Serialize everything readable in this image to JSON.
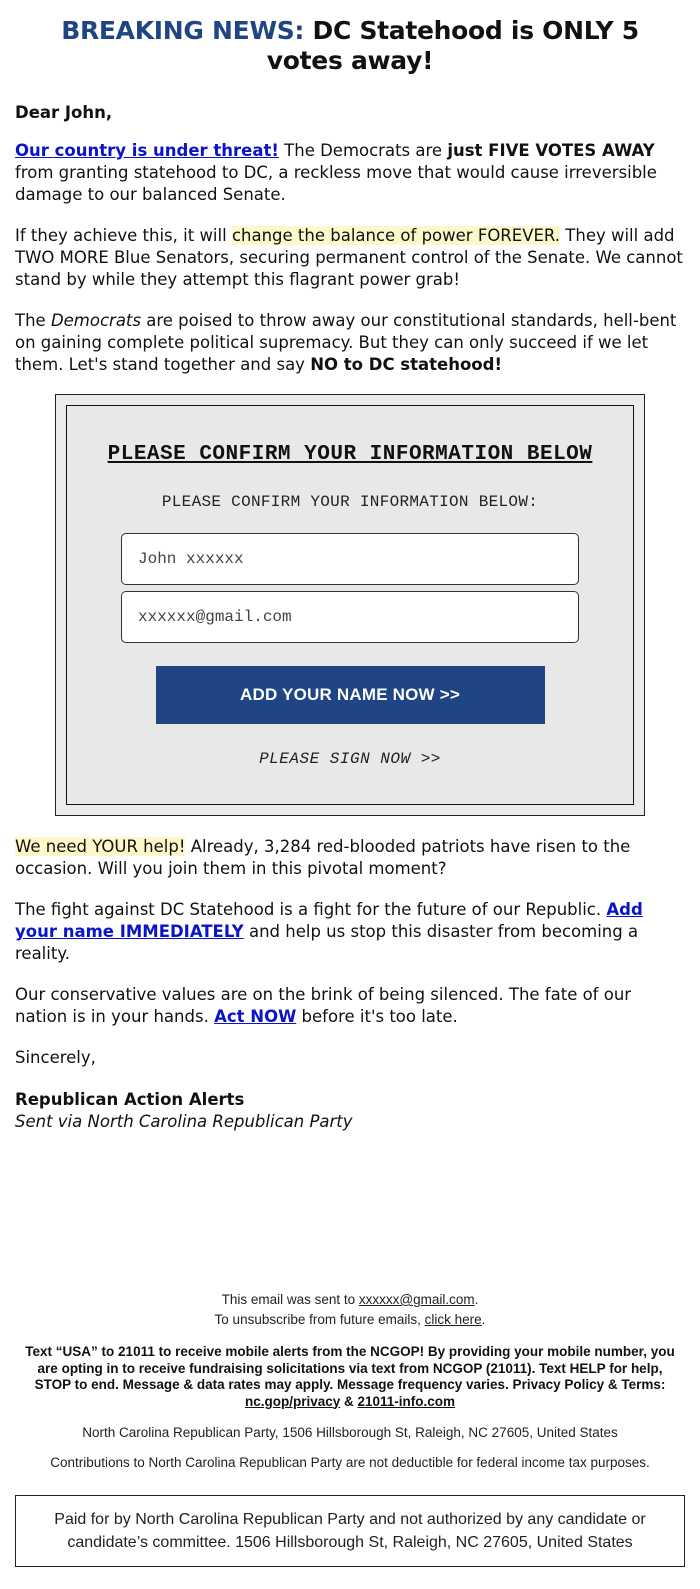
{
  "headline": {
    "lead": "BREAKING NEWS:",
    "rest": " DC Statehood is ONLY 5 votes away!"
  },
  "greeting": "Dear John,",
  "paragraphs": {
    "p1": {
      "link": "Our country is under threat!",
      "text1": " The Democrats are ",
      "bold": "just FIVE VOTES AWAY",
      "text2": " from granting statehood to DC, a reckless move that would cause irreversible damage to our balanced Senate."
    },
    "p2": {
      "text1": "If they achieve this, it will ",
      "highlight": "change the balance of power FOREVER.",
      "text2": " They will add TWO MORE Blue Senators, securing permanent control of the Senate. We cannot stand by while they attempt this flagrant power grab!"
    },
    "p3": {
      "text1": "The ",
      "italic": "Democrats",
      "text2": " are poised to throw away our constitutional standards, hell-bent on gaining complete political supremacy. But they can only succeed if we let them. Let's stand together and say ",
      "bold": "NO to DC statehood!"
    },
    "p4": {
      "highlight": "We need YOUR help!",
      "text": " Already, 3,284 red-blooded patriots have risen to the occasion. Will you join them in this pivotal moment?"
    },
    "p5": {
      "text1": "The fight against DC Statehood is a fight for the future of our Republic. ",
      "link": "Add your name IMMEDIATELY",
      "text2": " and help us stop this disaster from becoming a reality."
    },
    "p6": {
      "text1": "Our conservative values are on the brink of being silenced. The fate of our nation is in your hands. ",
      "link": "Act NOW",
      "text2": " before it's too late."
    }
  },
  "form": {
    "title": "PLEASE CONFIRM YOUR INFORMATION BELOW",
    "subtitle": "PLEASE CONFIRM YOUR INFORMATION BELOW:",
    "name_value": "John xxxxxx",
    "email_value": "xxxxxx@gmail.com",
    "submit_label": "ADD YOUR NAME NOW >>",
    "sign_now": "PLEASE SIGN NOW >>",
    "button_color": "#1f4585"
  },
  "signature": {
    "closing": "Sincerely,",
    "sender": "Republican Action Alerts",
    "via": "Sent via North Carolina Republican Party"
  },
  "footer": {
    "sent_to_prefix": "This email was sent to ",
    "sent_to_email": "xxxxxx@gmail.com",
    "sent_to_suffix": ".",
    "unsub_prefix": "To unsubscribe from future emails, ",
    "unsub_link": "click here",
    "unsub_suffix": ".",
    "sms_text": "Text “USA” to 21011 to receive mobile alerts from the NCGOP! By providing your mobile number, you are opting in to receive fundraising solicitations via text from NCGOP (21011). Text HELP for help, STOP to end. Message & data rates may apply. Message frequency varies. Privacy Policy & Terms: ",
    "privacy_link": "nc.gop/privacy",
    "amp": " & ",
    "info_link": "21011-info.com",
    "address": "North Carolina Republican Party, 1506 Hillsborough St, Raleigh, NC 27605, United States",
    "tax_note": "Contributions to North Carolina Republican Party are not deductible for federal income tax purposes.",
    "paid_for": "Paid for by North Carolina Republican Party and not authorized by any candidate or candidate’s committee. 1506 Hillsborough St, Raleigh, NC 27605, United States"
  },
  "colors": {
    "brand_blue": "#1f4585",
    "link_blue": "#0a14c8",
    "highlight": "#fdf7c9"
  }
}
